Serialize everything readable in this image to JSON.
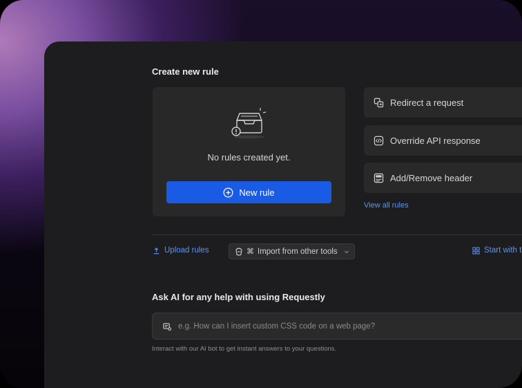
{
  "create": {
    "title": "Create new rule",
    "empty_text": "No rules created yet.",
    "new_rule_label": "New rule"
  },
  "rule_types": [
    {
      "label": "Redirect a request",
      "icon": "redirect-icon"
    },
    {
      "label": "Override API response",
      "icon": "code-icon"
    },
    {
      "label": "Add/Remove header",
      "icon": "header-icon"
    }
  ],
  "view_all_label": "View all rules",
  "actions": {
    "upload_label": "Upload rules",
    "import_label": "Import from other tools",
    "start_label": "Start with template"
  },
  "ai": {
    "title": "Ask AI for any help with using Requestly",
    "placeholder": "e.g. How can I insert custom CSS code on a web page?",
    "help": "Interact with our AI bot to get instant answers to your questions."
  },
  "colors": {
    "accent": "#1a5be6",
    "link": "#5b95f5",
    "panel": "#1d1d1f",
    "card": "#282829"
  }
}
